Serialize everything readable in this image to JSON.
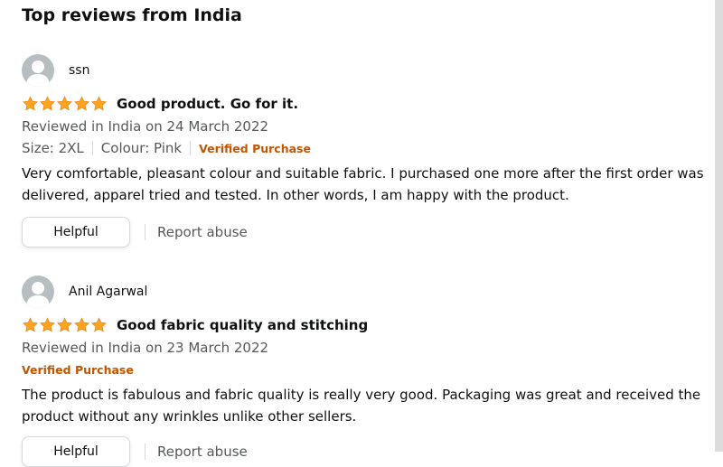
{
  "page": {
    "title": "Top reviews from India"
  },
  "colors": {
    "star": "#ffa41c",
    "verified": "#c45500",
    "muted_text": "#565959",
    "avatar_bg": "#b6bec1"
  },
  "reviews": [
    {
      "author": "ssn",
      "avatar_icon": "person-icon",
      "rating": 5,
      "title": "Good product. Go for it.",
      "date": "Reviewed in India on 24 March 2022",
      "size": "Size: 2XL",
      "colour": "Colour: Pink",
      "verified": "Verified Purchase",
      "body": "Very comfortable, pleasant colour and suitable fabric. I purchased one more after the first order was delivered, apparel tried and tested. In other words, I am happy with the product.",
      "helpful_label": "Helpful",
      "report_label": "Report abuse"
    },
    {
      "author": "Anil Agarwal",
      "avatar_icon": "person-icon",
      "rating": 5,
      "title": "Good fabric quality and stitching",
      "date": "Reviewed in India on 23 March 2022",
      "verified": "Verified Purchase",
      "body": "The product is fabulous and fabric quality is really very good. Packaging was great and received the product without any wrinkles unlike other sellers.",
      "helpful_label": "Helpful",
      "report_label": "Report abuse"
    }
  ]
}
